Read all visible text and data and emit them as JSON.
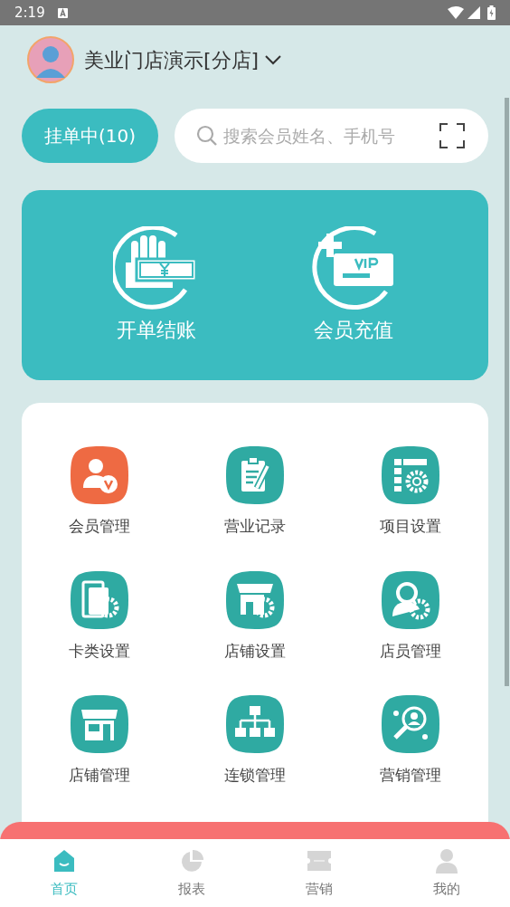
{
  "status_bar": {
    "time": "2:19"
  },
  "header": {
    "store_name": "美业门店演示[分店]"
  },
  "pending_button": {
    "label": "挂单中(10)"
  },
  "search": {
    "placeholder": "搜索会员姓名、手机号"
  },
  "actions": [
    {
      "label": "开单结账",
      "kind": "checkout"
    },
    {
      "label": "会员充值",
      "kind": "recharge"
    }
  ],
  "menu": [
    {
      "label": "会员管理",
      "kind": "member",
      "color": "#ee6a43"
    },
    {
      "label": "营业记录",
      "kind": "record",
      "color": "#2faaa2"
    },
    {
      "label": "项目设置",
      "kind": "project",
      "color": "#2faaa2"
    },
    {
      "label": "卡类设置",
      "kind": "card",
      "color": "#2faaa2"
    },
    {
      "label": "店铺设置",
      "kind": "shopset",
      "color": "#2faaa2"
    },
    {
      "label": "店员管理",
      "kind": "staff",
      "color": "#2faaa2"
    },
    {
      "label": "店铺管理",
      "kind": "shop",
      "color": "#2faaa2"
    },
    {
      "label": "连锁管理",
      "kind": "chain",
      "color": "#2faaa2"
    },
    {
      "label": "营销管理",
      "kind": "marketing",
      "color": "#2faaa2"
    }
  ],
  "tabs": [
    {
      "label": "首页",
      "kind": "home",
      "selected": true
    },
    {
      "label": "报表",
      "kind": "report",
      "selected": false
    },
    {
      "label": "营销",
      "kind": "ticket",
      "selected": false
    },
    {
      "label": "我的",
      "kind": "user",
      "selected": false
    }
  ]
}
